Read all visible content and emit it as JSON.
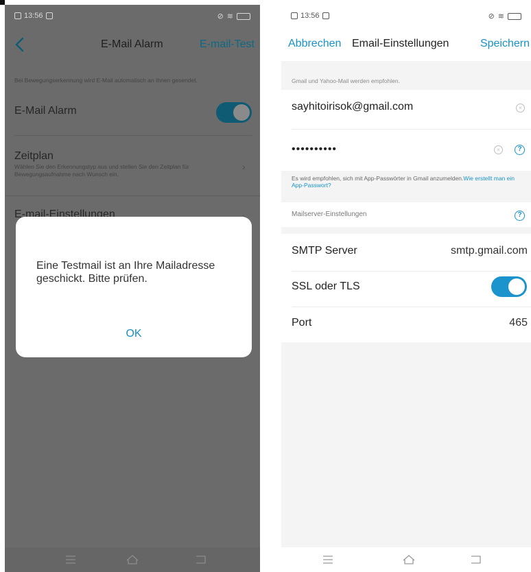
{
  "left": {
    "status": {
      "time": "13:56"
    },
    "header": {
      "title": "E-Mail Alarm",
      "action": "E-mail-Test"
    },
    "hint": "Bei Bewegungserkennung wird E-Mail automatisch an Ihnen gesendet.",
    "email_alarm": {
      "label": "E-Mail Alarm",
      "enabled": true
    },
    "schedule": {
      "label": "Zeitplan",
      "description": "Wählen Sie den Erkennungstyp aus und stellen Sie den Zeitplan für Bewegungsaufnahme nach Wunsch ein."
    },
    "email_settings_label": "E-mail-Einstellungen",
    "dialog": {
      "message": "Eine Testmail ist an Ihre Mailadresse geschickt. Bitte prüfen.",
      "ok_label": "OK"
    }
  },
  "right": {
    "status": {
      "time": "13:56"
    },
    "header": {
      "cancel": "Abbrechen",
      "title": "Email-Einstellungen",
      "save": "Speichern"
    },
    "recommend_hint": "Gmail und Yahoo-Mail werden empfohlen.",
    "email_value": "sayhitoirisok@gmail.com",
    "password_value": "••••••••••",
    "app_password_hint": "Es wird empfohlen, sich mit App-Passwörter in Gmail anzumelden.",
    "app_password_link": "Wie erstellt man ein App-Passwort?",
    "mailserver_label": "Mailserver-Einstellungen",
    "smtp": {
      "label": "SMTP Server",
      "value": "smtp.gmail.com"
    },
    "ssl": {
      "label": "SSL oder TLS",
      "enabled": true
    },
    "port": {
      "label": "Port",
      "value": "465"
    }
  },
  "colors": {
    "accent": "#1792c9",
    "overlay": "#6b6b6b",
    "toggle_on": "#1b93cc"
  },
  "icons": [
    "back-icon",
    "menu-icon",
    "home-icon",
    "return-icon",
    "clear-icon",
    "help-icon",
    "chevron-right-icon"
  ]
}
